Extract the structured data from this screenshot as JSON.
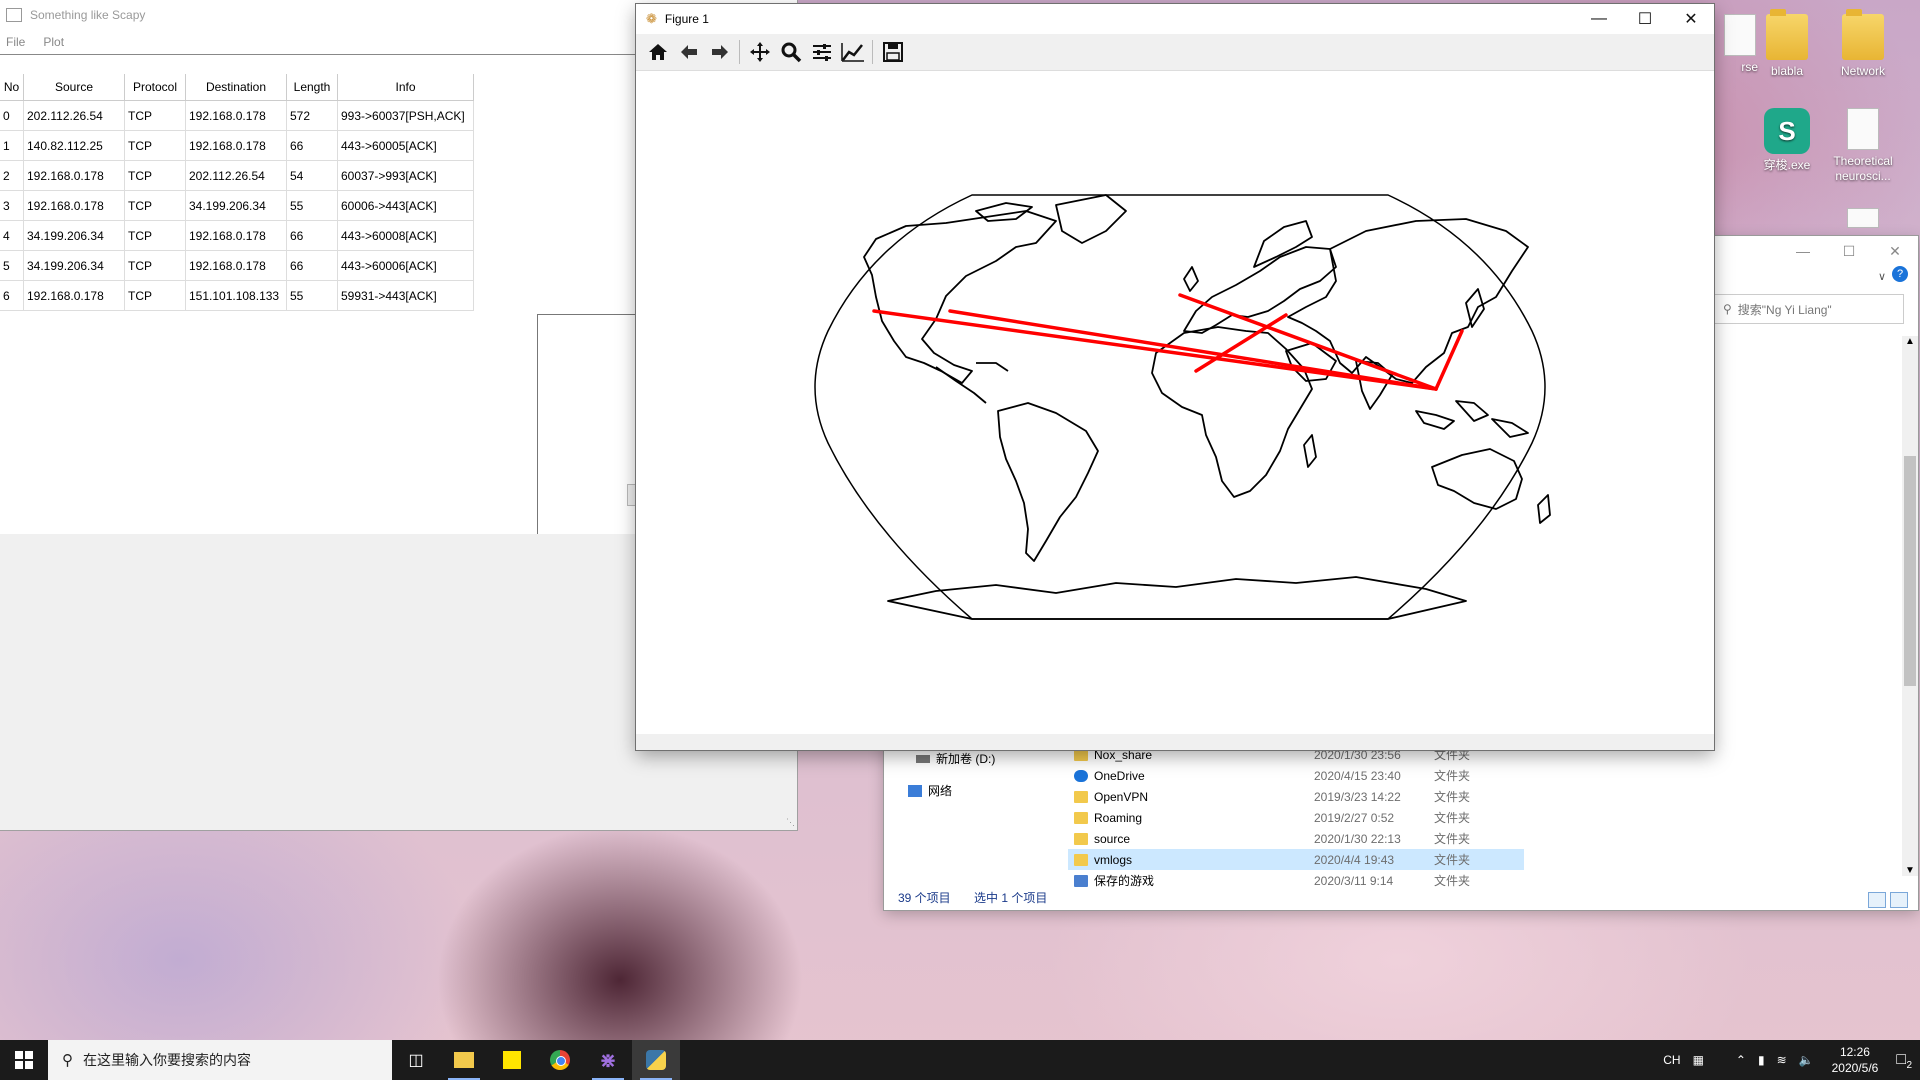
{
  "desktop": {
    "icons": [
      {
        "label": "rse"
      },
      {
        "label": "blabla"
      },
      {
        "label": "Network"
      },
      {
        "label": "穿梭.exe"
      },
      {
        "label": "Theoretical neurosci..."
      }
    ]
  },
  "scapy": {
    "title": "Something like Scapy",
    "menu": [
      "File",
      "Plot"
    ],
    "columns": [
      "No",
      "Source",
      "Protocol",
      "Destination",
      "Length",
      "Info"
    ],
    "rows": [
      [
        "0",
        "202.112.26.54",
        "TCP",
        "192.168.0.178",
        "572",
        "993->60037[PSH,ACK]"
      ],
      [
        "1",
        "140.82.112.25",
        "TCP",
        "192.168.0.178",
        "66",
        "443->60005[ACK]"
      ],
      [
        "2",
        "192.168.0.178",
        "TCP",
        "202.112.26.54",
        "54",
        "60037->993[ACK]"
      ],
      [
        "3",
        "192.168.0.178",
        "TCP",
        "34.199.206.34",
        "55",
        "60006->443[ACK]"
      ],
      [
        "4",
        "34.199.206.34",
        "TCP",
        "192.168.0.178",
        "66",
        "443->60008[ACK]"
      ],
      [
        "5",
        "34.199.206.34",
        "TCP",
        "192.168.0.178",
        "66",
        "443->60006[ACK]"
      ],
      [
        "6",
        "192.168.0.178",
        "TCP",
        "151.101.108.133",
        "55",
        "59931->443[ACK]"
      ]
    ]
  },
  "figure": {
    "title": "Figure 1",
    "toolbar": [
      "home-icon",
      "back-icon",
      "forward-icon",
      "pan-icon",
      "zoom-icon",
      "subplots-icon",
      "customize-icon",
      "save-icon"
    ],
    "route_color": "#ff0000"
  },
  "explorer": {
    "search_placeholder": "搜索\"Ng Yi Liang\"",
    "nav": [
      {
        "label": "新加卷 (D:)"
      },
      {
        "label": "网络"
      }
    ],
    "files": [
      {
        "name": "Nox_share",
        "date": "2020/1/30 23:56",
        "type": "文件夹",
        "icon": "folder"
      },
      {
        "name": "OneDrive",
        "date": "2020/4/15 23:40",
        "type": "文件夹",
        "icon": "cloud"
      },
      {
        "name": "OpenVPN",
        "date": "2019/3/23 14:22",
        "type": "文件夹",
        "icon": "folder"
      },
      {
        "name": "Roaming",
        "date": "2019/2/27 0:52",
        "type": "文件夹",
        "icon": "folder"
      },
      {
        "name": "source",
        "date": "2020/1/30 22:13",
        "type": "文件夹",
        "icon": "folder"
      },
      {
        "name": "vmlogs",
        "date": "2020/4/4 19:43",
        "type": "文件夹",
        "icon": "folder",
        "selected": true
      },
      {
        "name": "保存的游戏",
        "date": "2020/3/11 9:14",
        "type": "文件夹",
        "icon": "game"
      }
    ],
    "status": {
      "count": "39 个项目",
      "selected": "选中 1 个项目"
    }
  },
  "taskbar": {
    "search_placeholder": "在这里输入你要搜索的内容",
    "apps": [
      "task-view-icon",
      "file-explorer-icon",
      "sticky-notes-icon",
      "chrome-icon",
      "visual-studio-icon",
      "python-icon"
    ],
    "ime": "CH",
    "time": "12:26",
    "date": "2020/5/6",
    "notifications": "2"
  }
}
